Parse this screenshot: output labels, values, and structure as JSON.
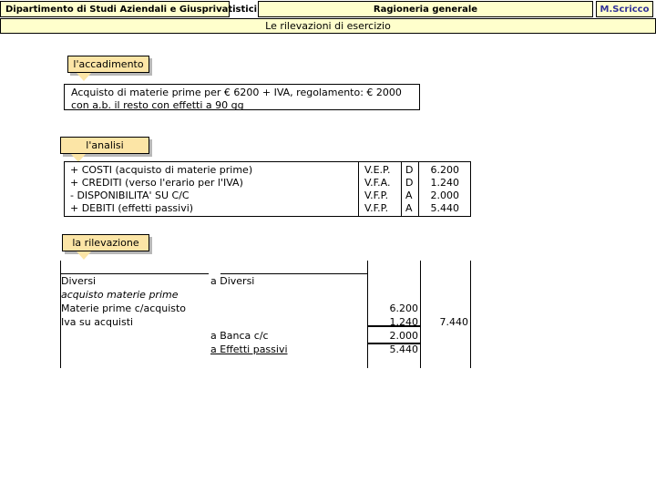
{
  "header": {
    "left_title": "Dipartimento di Studi Aziendali e Giusprivatistici",
    "center_title": "Ragioneria generale",
    "brand": "M.Scricco",
    "subtitle": "Le rilevazioni di esercizio"
  },
  "accadimento": {
    "label": "l'accadimento",
    "text_line1": "Acquisto di materie prime per € 6200 + IVA, regolamento: € 2000",
    "text_line2": "con a.b. il resto con effetti a 90 gg"
  },
  "analisi": {
    "label": "l'analisi",
    "rows": [
      {
        "desc": "+ COSTI (acquisto di materie prime)",
        "var": "V.E.P.",
        "side": "D",
        "amount": "6.200"
      },
      {
        "desc": "+ CREDITI (verso l'erario per l'IVA)",
        "var": "V.F.A.",
        "side": "D",
        "amount": "1.240"
      },
      {
        "desc": "- DISPONIBILITA' SU C/C",
        "var": "V.F.P.",
        "side": "A",
        "amount": "2.000"
      },
      {
        "desc": "+ DEBITI (effetti passivi)",
        "var": "V.F.P.",
        "side": "A",
        "amount": "5.440"
      }
    ]
  },
  "rilevazione": {
    "label": "la rilevazione",
    "debit_header": "Diversi",
    "credit_header": "a Diversi",
    "debit_note": "acquisto materie prime",
    "debit_accounts": [
      "Materie prime c/acquisto",
      "Iva su acquisti"
    ],
    "credit_accounts": [
      "a Banca c/c",
      "a Effetti passivi"
    ],
    "partial_amounts": [
      "6.200",
      "1.240",
      "2.000",
      "5.440"
    ],
    "total_amount": "7.440"
  }
}
